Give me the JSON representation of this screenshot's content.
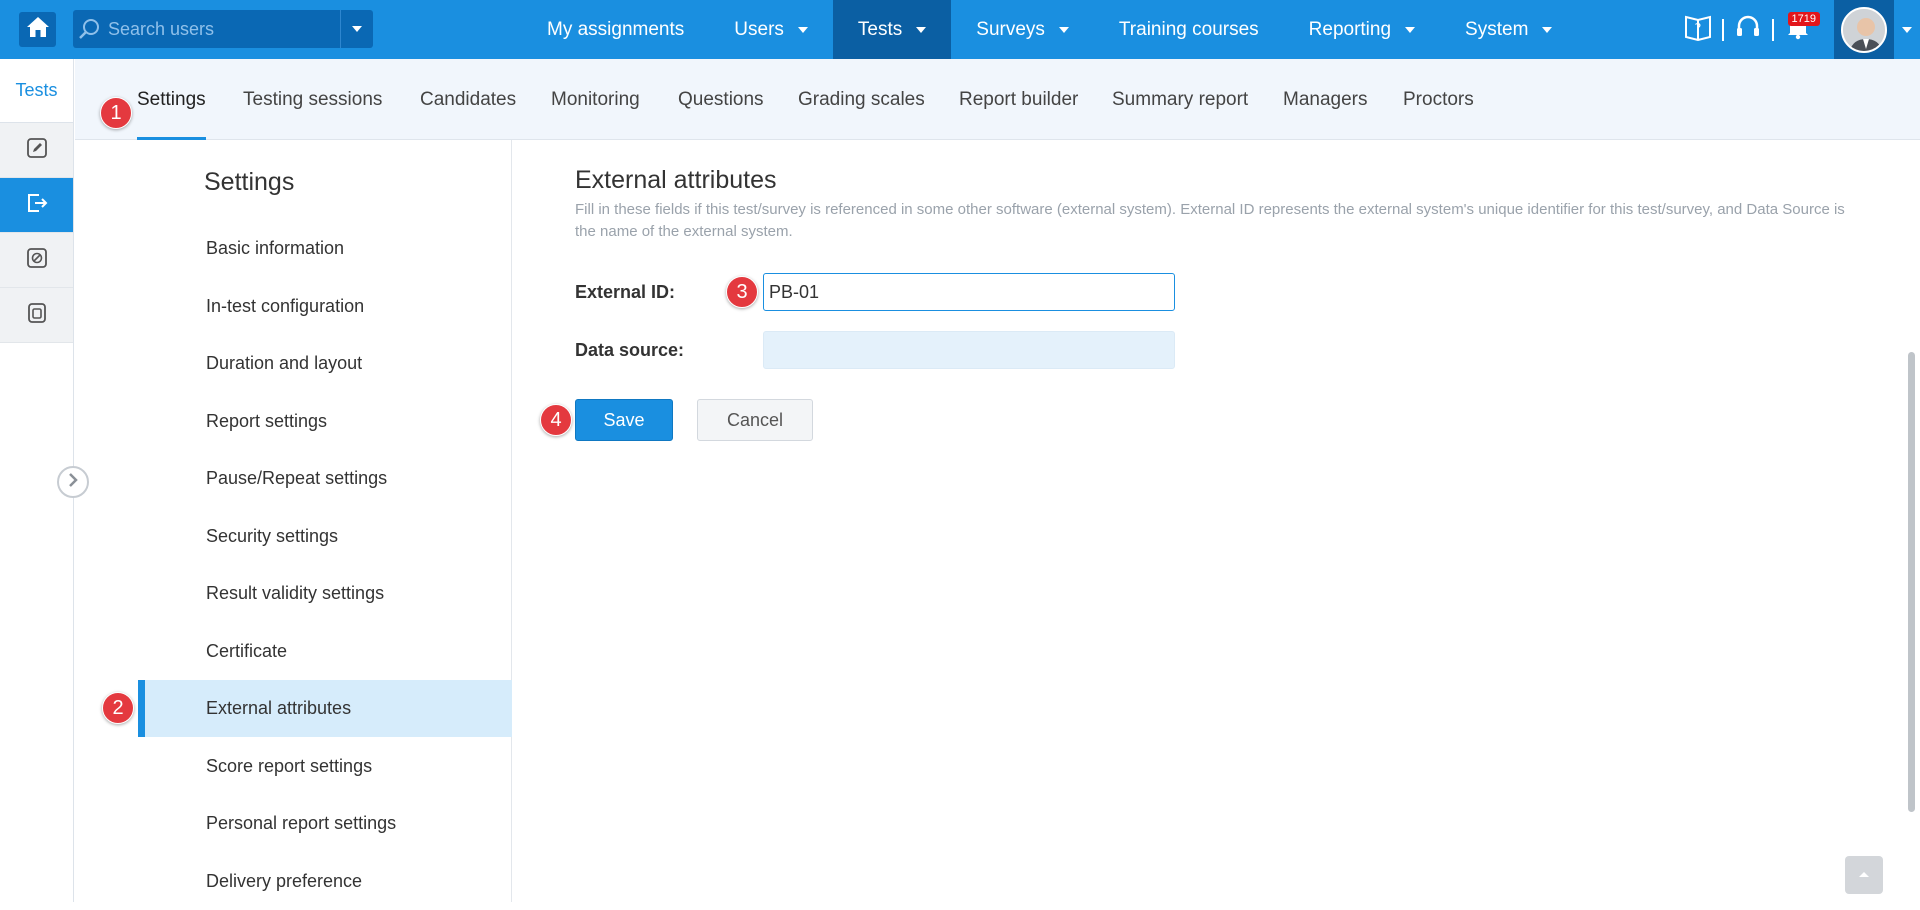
{
  "topbar": {
    "search_placeholder": "Search users",
    "nav": [
      {
        "label": "My assignments",
        "has_caret": false
      },
      {
        "label": "Users",
        "has_caret": true
      },
      {
        "label": "Tests",
        "has_caret": true,
        "active": true
      },
      {
        "label": "Surveys",
        "has_caret": true
      },
      {
        "label": "Training courses",
        "has_caret": false
      },
      {
        "label": "Reporting",
        "has_caret": true
      },
      {
        "label": "System",
        "has_caret": true
      }
    ],
    "notification_count": "1719",
    "icons": [
      "home-icon",
      "search-icon",
      "help-book-icon",
      "headset-icon",
      "bell-icon"
    ]
  },
  "rail": {
    "title": "Tests",
    "buttons": [
      "edit-icon",
      "publish-icon",
      "block-icon",
      "copy-icon"
    ]
  },
  "tabs": [
    {
      "label": "Settings",
      "active": true
    },
    {
      "label": "Testing sessions"
    },
    {
      "label": "Candidates"
    },
    {
      "label": "Monitoring"
    },
    {
      "label": "Questions"
    },
    {
      "label": "Grading scales"
    },
    {
      "label": "Report builder"
    },
    {
      "label": "Summary report"
    },
    {
      "label": "Managers"
    },
    {
      "label": "Proctors"
    }
  ],
  "settings": {
    "title": "Settings",
    "items": [
      "Basic information",
      "In-test configuration",
      "Duration and layout",
      "Report settings",
      "Pause/Repeat settings",
      "Security settings",
      "Result validity settings",
      "Certificate",
      "External attributes",
      "Score report settings",
      "Personal report settings",
      "Delivery preference"
    ],
    "active_index": 8
  },
  "content": {
    "title": "External attributes",
    "description": "Fill in these fields if this test/survey is referenced in some other software (external system). External ID represents the external system's unique identifier for this test/survey, and Data Source is the name of the external system.",
    "external_id_label": "External ID:",
    "external_id_value": "PB-01",
    "data_source_label": "Data source:",
    "data_source_value": "",
    "save_label": "Save",
    "cancel_label": "Cancel"
  },
  "markers": [
    "1",
    "2",
    "3",
    "4"
  ],
  "colors": {
    "brand_blue": "#1a8fe0",
    "active_nav": "#0b5fa3",
    "marker_red": "#e4393f",
    "selected_row": "#d6ecfb"
  }
}
